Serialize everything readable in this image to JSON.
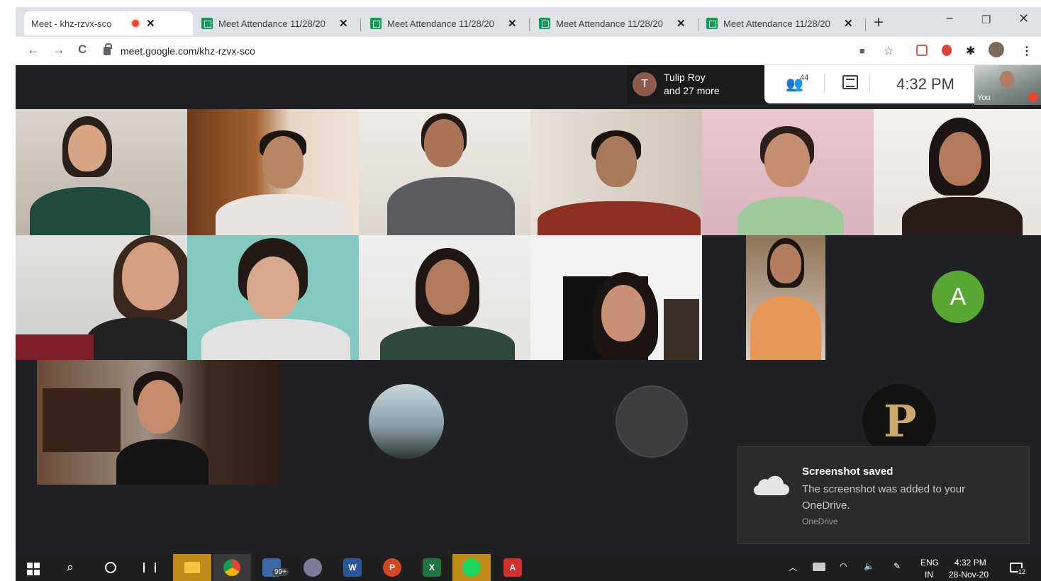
{
  "browser": {
    "tabs": [
      {
        "title": "Meet - khz-rzvx-sco",
        "recording": true
      },
      {
        "title": "Meet Attendance 11/28/20"
      },
      {
        "title": "Meet Attendance 11/28/20"
      },
      {
        "title": "Meet Attendance 11/28/20"
      },
      {
        "title": "Meet Attendance 11/28/20"
      }
    ],
    "new_tab": "+",
    "window_controls": {
      "minimize": "−",
      "restore": "❐",
      "close": "✕"
    },
    "url": "meet.google.com/khz-rzvx-sco",
    "nav": {
      "back": "←",
      "forward": "→",
      "reload": "C"
    }
  },
  "meet": {
    "presenter": {
      "initial": "T",
      "name": "Tulip Roy",
      "more": "and 27 more"
    },
    "participants_count": "44",
    "time": "4:32 PM",
    "self_label": "You",
    "avatar_initial": "A"
  },
  "toast": {
    "title": "Screenshot saved",
    "message": "The screenshot was added to your OneDrive.",
    "source": "OneDrive"
  },
  "taskbar": {
    "mail_badge": "99+",
    "lang": "ENG",
    "region": "IN",
    "time": "4:32 PM",
    "date": "28-Nov-20",
    "notif_count": "12"
  },
  "colors": {
    "meet_bg": "#202124",
    "accent_green": "#5aa635",
    "record_red": "#ea4335"
  }
}
